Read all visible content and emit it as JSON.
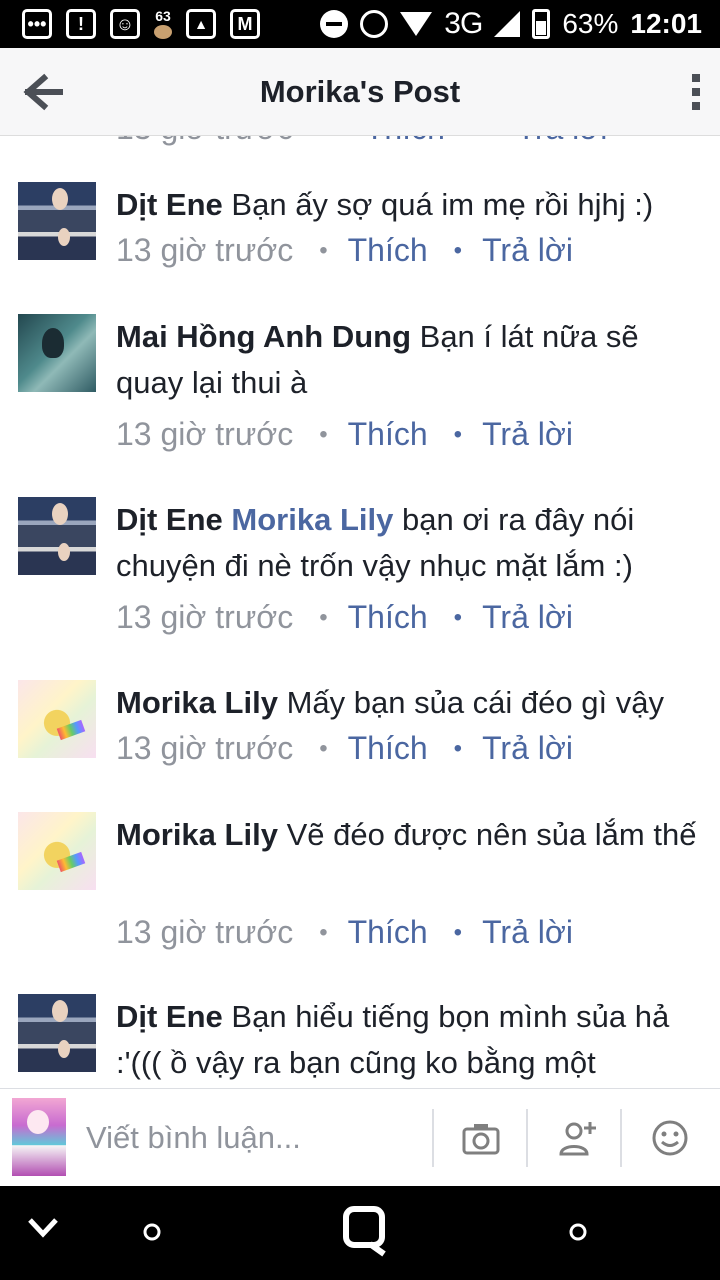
{
  "status_bar": {
    "notif_badge": "63",
    "net": "3G",
    "battery": "63%",
    "time": "12:01"
  },
  "header": {
    "title": "Morika's Post"
  },
  "peek": {
    "time": "13 giờ trước",
    "like": "Thích",
    "reply": "Trả lời"
  },
  "comments": [
    {
      "author": "Dịt Ene",
      "tag": "",
      "text": "Bạn ấy sợ quá im mẹ rồi hjhj :)",
      "time": "13 giờ trước",
      "like": "Thích",
      "reply": "Trả lời",
      "avatar": "dit"
    },
    {
      "author": "Mai Hồng Anh Dung",
      "tag": "",
      "text": "Bạn í lát nữa sẽ quay lại thui à",
      "time": "13 giờ trước",
      "like": "Thích",
      "reply": "Trả lời",
      "avatar": "mai"
    },
    {
      "author": "Dịt Ene",
      "tag": "Morika Lily",
      "text": "bạn ơi ra đây nói chuyện đi nè trốn vậy nhục mặt lắm :)",
      "time": "13 giờ trước",
      "like": "Thích",
      "reply": "Trả lời",
      "avatar": "dit"
    },
    {
      "author": "Morika Lily",
      "tag": "",
      "text": "Mấy bạn sủa cái đéo gì vậy",
      "time": "13 giờ trước",
      "like": "Thích",
      "reply": "Trả lời",
      "avatar": "morika"
    },
    {
      "author": "Morika Lily",
      "tag": "",
      "text": "Vẽ đéo được nên sủa lắm thế",
      "time": "13 giờ trước",
      "like": "Thích",
      "reply": "Trả lời",
      "avatar": "morika"
    },
    {
      "author": "Dịt Ene",
      "tag": "",
      "text": "Bạn hiểu tiếng bọn mình sủa hả :'((( ồ vậy ra bạn cũng ko bằng một",
      "time": "",
      "like": "",
      "reply": "",
      "avatar": "dit"
    }
  ],
  "composer": {
    "placeholder": "Viết bình luận..."
  },
  "colors": {
    "link": "#4b67a1",
    "meta": "#90949c",
    "text": "#1d2129"
  }
}
